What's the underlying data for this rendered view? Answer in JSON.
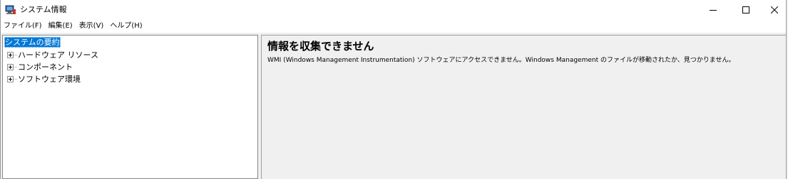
{
  "window": {
    "title": "システム情報",
    "icon": "system-info-icon",
    "controls": {
      "minimize": "minimize-icon",
      "maximize": "maximize-icon",
      "close": "close-icon"
    }
  },
  "menu": {
    "items": [
      {
        "label": "ファイル(F)"
      },
      {
        "label": "編集(E)"
      },
      {
        "label": "表示(V)"
      },
      {
        "label": "ヘルプ(H)"
      }
    ]
  },
  "tree": {
    "root": "システムの要約",
    "children": [
      {
        "label": "ハードウェア リソース"
      },
      {
        "label": "コンポーネント"
      },
      {
        "label": "ソフトウェア環境"
      }
    ]
  },
  "message": {
    "title": "情報を収集できません",
    "body": "WMI (Windows Management Instrumentation) ソフトウェアにアクセスできません。Windows Management のファイルが移動されたか、見つかりません。"
  },
  "colors": {
    "selection": "#0078d7",
    "background": "#f0f0f0"
  }
}
